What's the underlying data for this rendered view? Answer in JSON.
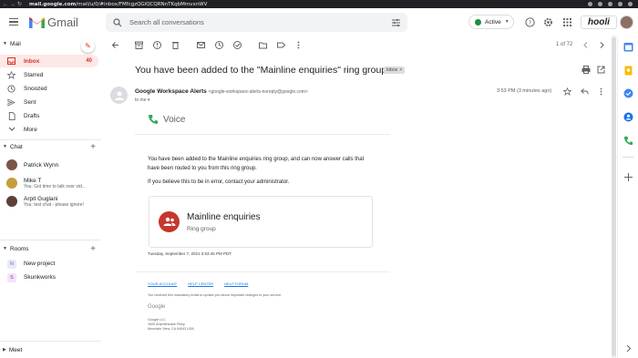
{
  "browser": {
    "url_host": "mail.google.com",
    "url_path": "/mail/u/0/#inbox/FMfcgzQGlQCQRNnTKqbMmvxnWV"
  },
  "app": {
    "name": "Gmail"
  },
  "search": {
    "placeholder": "Search all conversations"
  },
  "status": {
    "label": "Active",
    "color": "#1e8e3e"
  },
  "org_logo": "hooli",
  "sidebar": {
    "mail_header": "Mail",
    "items": [
      {
        "label": "Inbox",
        "count": "40",
        "icon": "inbox-icon",
        "selected": true
      },
      {
        "label": "Starred",
        "icon": "star-icon"
      },
      {
        "label": "Snoozed",
        "icon": "clock-icon"
      },
      {
        "label": "Sent",
        "icon": "send-icon"
      },
      {
        "label": "Drafts",
        "icon": "draft-icon"
      },
      {
        "label": "More",
        "icon": "chevron-down-icon"
      }
    ],
    "chat_header": "Chat",
    "chats": [
      {
        "name": "Patrick Wynn",
        "sub": ""
      },
      {
        "name": "Mike T",
        "sub": "You: Got time to talk over vid..."
      },
      {
        "name": "Arpit Guglani",
        "sub": "You: test chat - please ignore!"
      }
    ],
    "rooms_header": "Rooms",
    "rooms": [
      {
        "badge": "N",
        "label": "New project"
      },
      {
        "badge": "S",
        "label": "Skunkworks"
      }
    ],
    "meet_header": "Meet"
  },
  "toolbar": {
    "pager": "1 of 72"
  },
  "email": {
    "subject": "You have been added to the \"Mainline enquiries\" ring group",
    "label": "Inbox",
    "sender_name": "Google Workspace Alerts",
    "sender_email": "<google-workspace-alerts-noreply@google.com>",
    "to": "to me",
    "time": "3:53 PM (3 minutes ago)",
    "product": "Voice",
    "body_para1": "You have been added to the Mainline enquiries ring group, and can now answer calls that have been routed to you from this ring group.",
    "body_para2": "If you believe this to be in error, contact your administrator.",
    "card_title": "Mainline enquiries",
    "card_subtitle": "Ring group",
    "timestamp": "Tuesday, September 7, 2021 3:53:45 PM PDT",
    "links": [
      "YOUR ACCOUNT",
      "HELP CENTER",
      "HELP FORUM"
    ],
    "fine_print": "You received this mandatory email to update you about important changes to your service.",
    "footer_logo": "Google",
    "address_line1": "Google LLC",
    "address_line2": "1600 Amphitheatre Pkwy",
    "address_line3": "Mountain View, CA 94043 USA"
  },
  "colors": {
    "accent_red": "#d93025",
    "link_blue": "#1a73e8",
    "card_avatar": "#c5372c"
  }
}
